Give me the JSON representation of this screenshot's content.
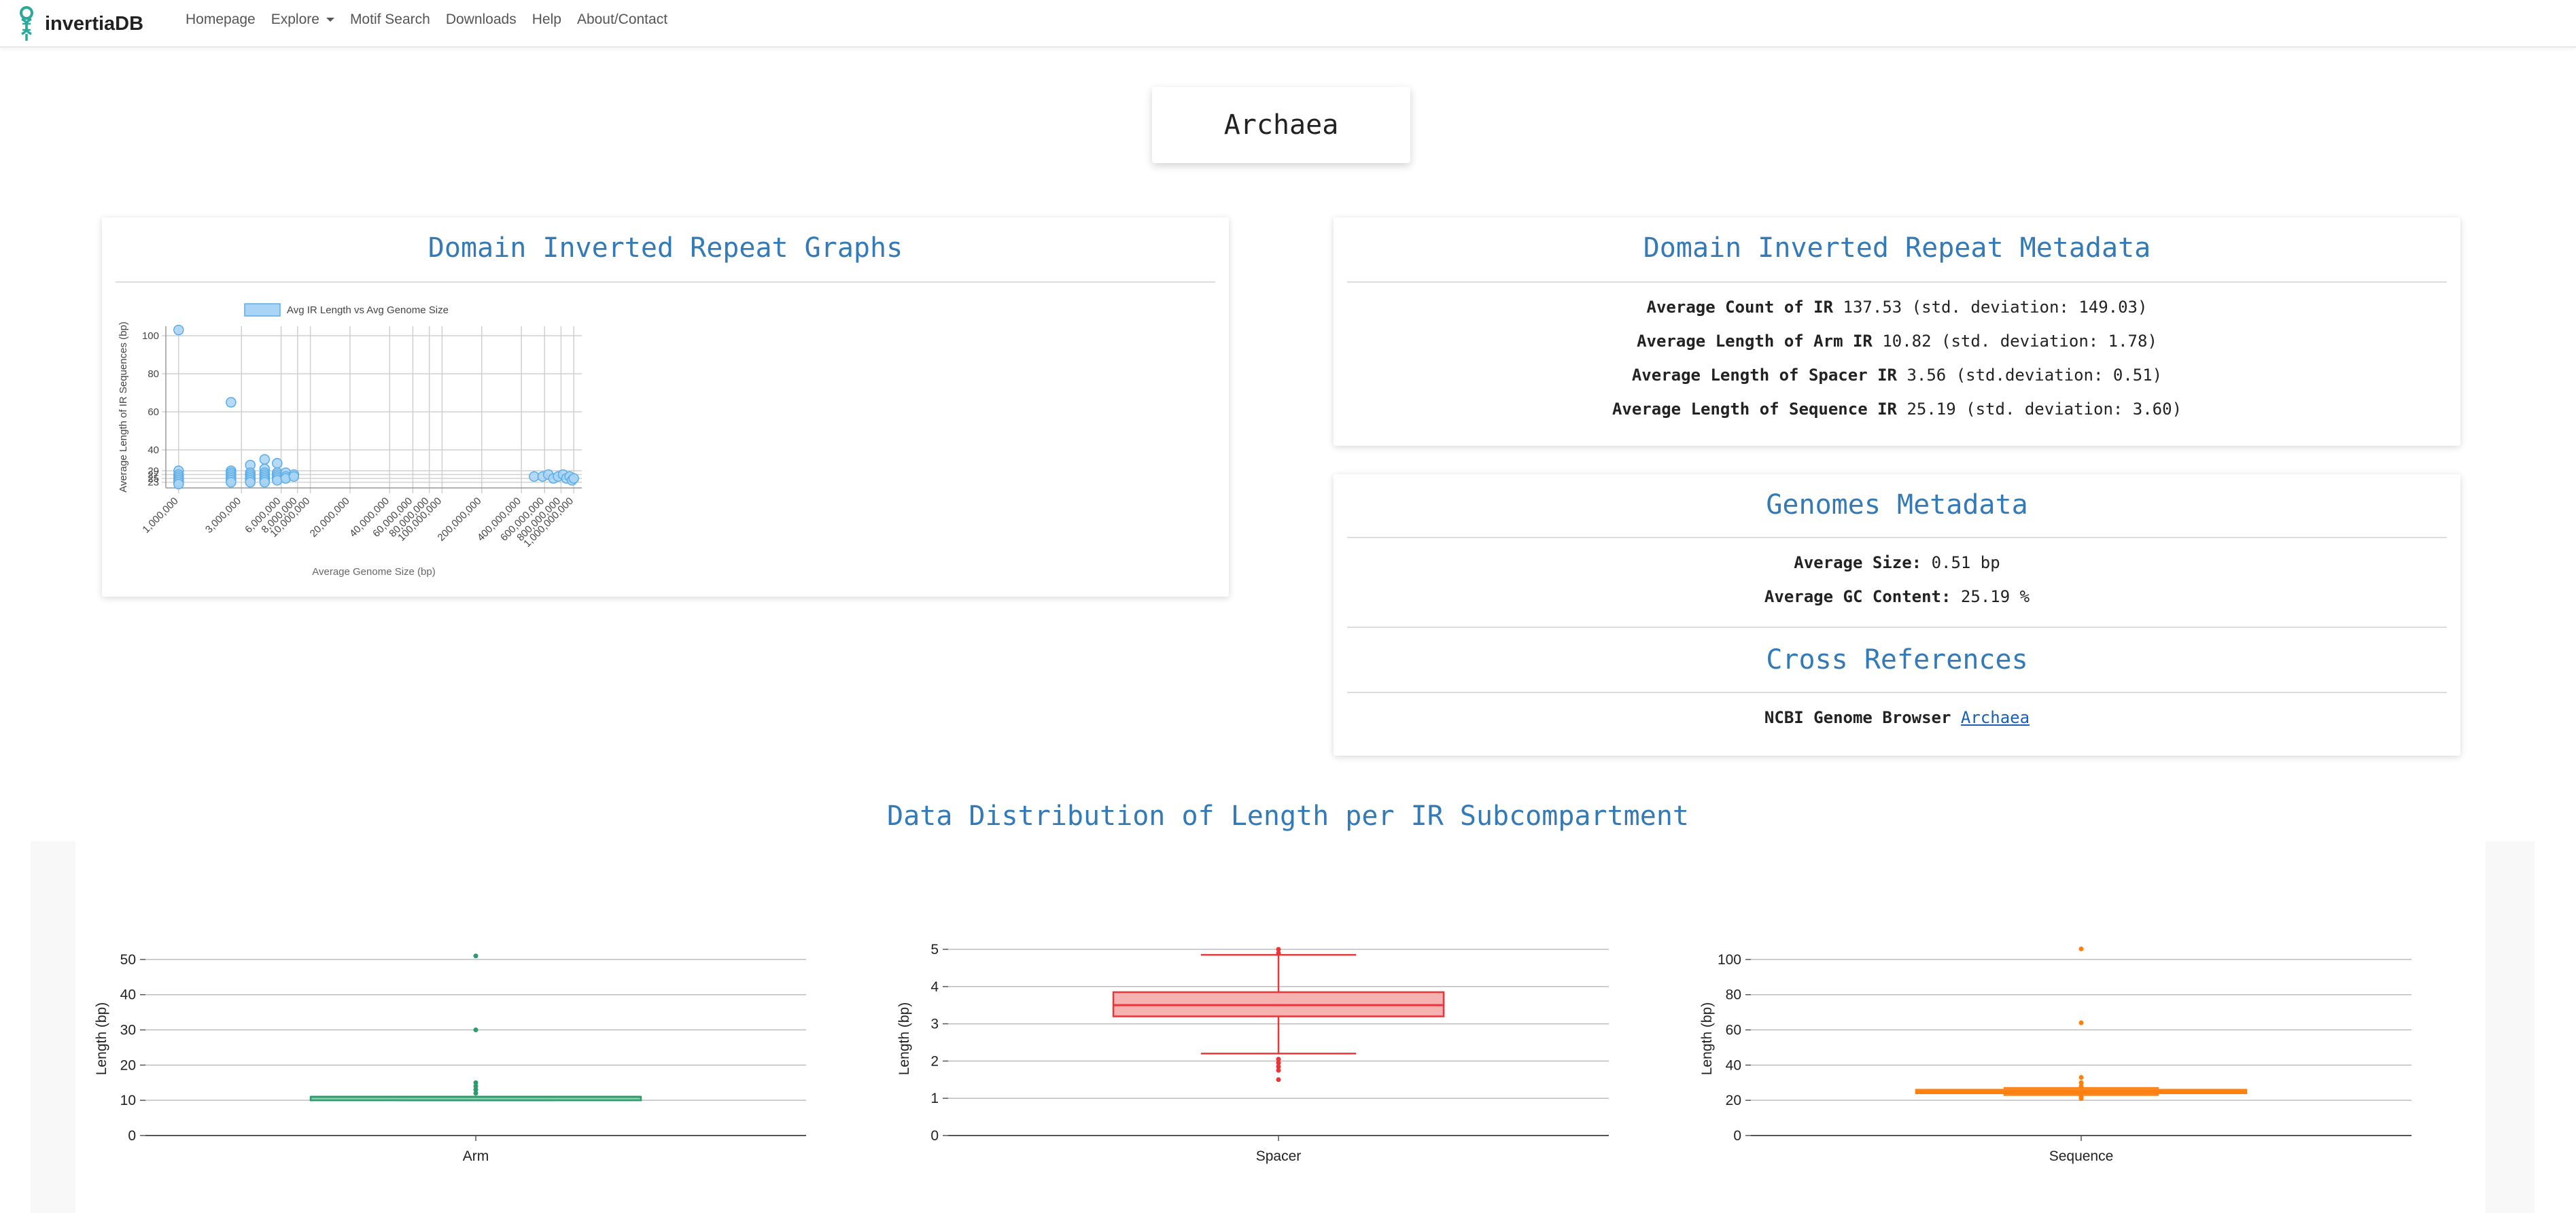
{
  "brand": {
    "name": "invertiaDB"
  },
  "nav": {
    "items": [
      "Homepage",
      "Explore",
      "Motif Search",
      "Downloads",
      "Help",
      "About/Contact"
    ]
  },
  "page_title": "Archaea",
  "graph_card": {
    "title": "Domain Inverted Repeat Graphs"
  },
  "metadata_card": {
    "title": "Domain Inverted Repeat Metadata",
    "lines": [
      {
        "label": "Average Count of IR",
        "value": "137.53 (std. deviation: 149.03)"
      },
      {
        "label": "Average Length of Arm IR",
        "value": "10.82 (std. deviation: 1.78)"
      },
      {
        "label": "Average Length of Spacer IR",
        "value": "3.56 (std.deviation: 0.51)"
      },
      {
        "label": "Average Length of Sequence IR",
        "value": "25.19 (std. deviation: 3.60)"
      }
    ]
  },
  "genomes_card": {
    "title": "Genomes Metadata",
    "size_label": "Average Size:",
    "size_value": "0.51 bp",
    "gc_label": "Average GC Content:",
    "gc_value": "25.19 %",
    "xref_title": "Cross References",
    "ncbi_label": "NCBI Genome Browser",
    "ncbi_link": "Archaea"
  },
  "distribution": {
    "title": "Data Distribution of Length per IR Subcompartment"
  },
  "colors": {
    "accent": "#337ab7",
    "scatter": "#5aade8",
    "arm": "#2e9b6e",
    "spacer": "#e8363a",
    "sequence": "#ff7f0e"
  },
  "chart_data": [
    {
      "type": "scatter",
      "legend": "Avg IR Length vs Avg Genome Size",
      "xlabel": "Average Genome Size (bp)",
      "ylabel": "Average Length of IR Sequences (bp)",
      "x_scale": "log",
      "x_ticks": [
        "1,000,000",
        "3,000,000",
        "6,000,000",
        "8,000,000",
        "10,000,000",
        "20,000,000",
        "40,000,000",
        "60,000,000",
        "80,000,000",
        "100,000,000",
        "200,000,000",
        "400,000,000",
        "600,000,000",
        "800,000,000",
        "1,000,000,000"
      ],
      "y_ticks": [
        "23",
        "25",
        "27",
        "29",
        "40",
        "60",
        "80",
        "100"
      ],
      "grid": true,
      "legend_position": "top",
      "points": [
        {
          "x": 1000000,
          "y": 103
        },
        {
          "x": 1000000,
          "y": 29
        },
        {
          "x": 1000000,
          "y": 27
        },
        {
          "x": 1000000,
          "y": 26
        },
        {
          "x": 1000000,
          "y": 25
        },
        {
          "x": 1000000,
          "y": 24
        },
        {
          "x": 1000000,
          "y": 23
        },
        {
          "x": 1000000,
          "y": 22
        },
        {
          "x": 2500000,
          "y": 65
        },
        {
          "x": 2500000,
          "y": 29
        },
        {
          "x": 2500000,
          "y": 28
        },
        {
          "x": 2500000,
          "y": 27
        },
        {
          "x": 2500000,
          "y": 26
        },
        {
          "x": 2500000,
          "y": 25
        },
        {
          "x": 2500000,
          "y": 24
        },
        {
          "x": 2500000,
          "y": 23
        },
        {
          "x": 3500000,
          "y": 32
        },
        {
          "x": 3500000,
          "y": 28
        },
        {
          "x": 3500000,
          "y": 27
        },
        {
          "x": 3500000,
          "y": 26
        },
        {
          "x": 3500000,
          "y": 25
        },
        {
          "x": 3500000,
          "y": 24
        },
        {
          "x": 3500000,
          "y": 23
        },
        {
          "x": 4500000,
          "y": 35
        },
        {
          "x": 4500000,
          "y": 30
        },
        {
          "x": 4500000,
          "y": 28
        },
        {
          "x": 4500000,
          "y": 27
        },
        {
          "x": 4500000,
          "y": 26
        },
        {
          "x": 4500000,
          "y": 25
        },
        {
          "x": 4500000,
          "y": 24
        },
        {
          "x": 4500000,
          "y": 23
        },
        {
          "x": 5600000,
          "y": 33
        },
        {
          "x": 5600000,
          "y": 28
        },
        {
          "x": 5600000,
          "y": 27
        },
        {
          "x": 5600000,
          "y": 26
        },
        {
          "x": 5600000,
          "y": 25
        },
        {
          "x": 5600000,
          "y": 24
        },
        {
          "x": 6500000,
          "y": 28
        },
        {
          "x": 6500000,
          "y": 26
        },
        {
          "x": 6500000,
          "y": 25
        },
        {
          "x": 7500000,
          "y": 27
        },
        {
          "x": 7500000,
          "y": 26
        },
        {
          "x": 500000000,
          "y": 26
        },
        {
          "x": 580000000,
          "y": 26
        },
        {
          "x": 640000000,
          "y": 27
        },
        {
          "x": 700000000,
          "y": 25
        },
        {
          "x": 760000000,
          "y": 26
        },
        {
          "x": 830000000,
          "y": 27
        },
        {
          "x": 880000000,
          "y": 25
        },
        {
          "x": 930000000,
          "y": 26
        },
        {
          "x": 970000000,
          "y": 24
        },
        {
          "x": 1000000000,
          "y": 25
        }
      ]
    },
    {
      "type": "box",
      "category": "Arm",
      "ylabel": "Length (bp)",
      "ylim": [
        0,
        55
      ],
      "y_ticks": [
        0,
        10,
        20,
        30,
        40,
        50
      ],
      "min": 10,
      "q1": 10,
      "median": 11,
      "q3": 11,
      "max": 11,
      "outliers": [
        12,
        13,
        14,
        15,
        30,
        51
      ]
    },
    {
      "type": "box",
      "category": "Spacer",
      "ylabel": "Length (bp)",
      "ylim": [
        0,
        5.2
      ],
      "y_ticks": [
        0,
        1,
        2,
        3,
        4,
        5
      ],
      "min": 2.2,
      "q1": 3.2,
      "median": 3.5,
      "q3": 3.85,
      "max": 4.85,
      "outliers": [
        1.5,
        1.75,
        1.85,
        1.95,
        2.05,
        4.9,
        5.0
      ]
    },
    {
      "type": "box",
      "category": "Sequence",
      "ylabel": "Length (bp)",
      "ylim": [
        0,
        110
      ],
      "y_ticks": [
        0,
        20,
        40,
        60,
        80,
        100
      ],
      "min": 23,
      "q1": 24,
      "median": 25,
      "q3": 26,
      "max": 27,
      "outliers": [
        21,
        22,
        28,
        30,
        33,
        64,
        106
      ]
    }
  ]
}
